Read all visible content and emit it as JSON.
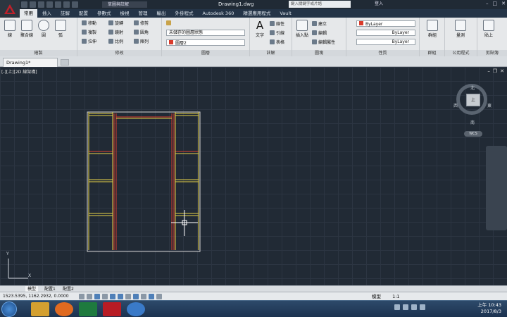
{
  "titlebar": {
    "workspace": "草圖與註解",
    "document_title": "Drawing1.dwg",
    "search_placeholder": "鍵入關鍵字或片語",
    "login": "登入",
    "app_letter": "A"
  },
  "tabs": [
    "常用",
    "插入",
    "註解",
    "配置",
    "參數式",
    "檢視",
    "管理",
    "輸出",
    "外掛程式",
    "Autodesk 360",
    "精選應用程式",
    "Vault"
  ],
  "active_tab": "常用",
  "ribbon": {
    "draw": {
      "label": "繪製",
      "tools": [
        "線",
        "聚合線",
        "圓",
        "弧"
      ]
    },
    "modify": {
      "label": "修改",
      "tools": [
        "移動",
        "旋轉",
        "修剪",
        "複製",
        "鏡射",
        "圓角",
        "拉伸",
        "比例",
        "陣列"
      ]
    },
    "layers": {
      "label": "圖層",
      "dropdown1": "未儲存的圖層狀態",
      "dropdown2": "圖層2"
    },
    "annotation": {
      "label": "註解",
      "text_tool": "文字",
      "tools": [
        "線性",
        "引線",
        "表格"
      ]
    },
    "block": {
      "label": "圖塊",
      "insert": "插入點",
      "tools": [
        "建立",
        "編輯",
        "編輯屬性"
      ]
    },
    "properties": {
      "label": "性質",
      "color": "ByLayer",
      "linetype": "ByLayer",
      "lineweight": "ByLayer"
    },
    "groups": {
      "label": "群組",
      "tool": "群組"
    },
    "utilities": {
      "label": "公用程式",
      "tool": "量測"
    },
    "clipboard": {
      "label": "剪貼簿",
      "tool": "貼上"
    }
  },
  "doc_tab": {
    "name": "Drawing1*"
  },
  "viewport": {
    "label": "[-][上][2D 線架構]"
  },
  "viewcube": {
    "north": "北",
    "south": "南",
    "east": "東",
    "west": "西",
    "face": "上",
    "wcs": "WCS"
  },
  "axes": {
    "x": "X",
    "y": "Y"
  },
  "layout_tabs": [
    "模型",
    "配置1",
    "配置2"
  ],
  "status": {
    "coords": "1523.5395, 1162.2932, 0.0000",
    "model": "模型",
    "scale": "1:1"
  },
  "colors": {
    "bg": "#212a35",
    "wall": "#d6d6d6",
    "frame_red": "#d93b2b",
    "shelf_yellow": "#e8d347"
  },
  "clock": {
    "time": "上午 10:43",
    "date": "2017/8/3"
  }
}
